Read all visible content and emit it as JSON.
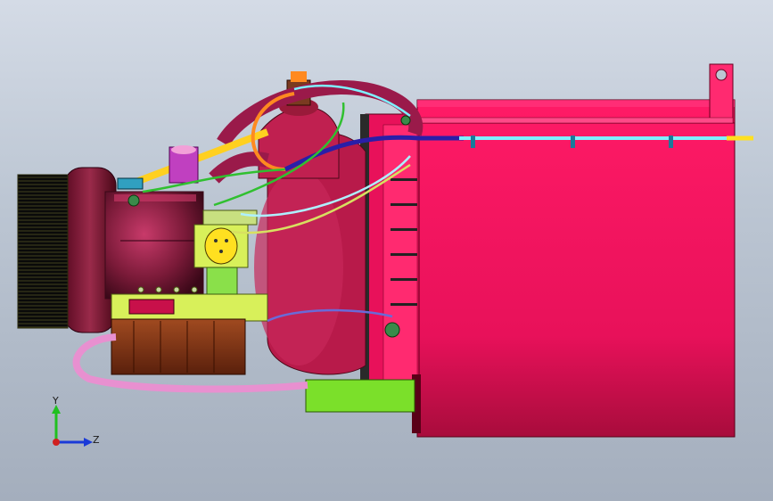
{
  "viewport": {
    "background_top": "#d4dbe6",
    "background_bottom": "#a4aebd"
  },
  "colors": {
    "housing": "#e8115a",
    "housing_dark": "#8b0a2e",
    "blower": "#7a1a38",
    "filter_face": "#111111",
    "pump_yellow": "#d8f05a",
    "pump_brown": "#8a3a1a",
    "green_block": "#7be02a",
    "gas_pipe": "#ffd020",
    "water_pipe": "#e890d0",
    "fuel_line": "#2a1ea8",
    "sensor_line": "#7ef0ff"
  },
  "triad": {
    "y_label": "Y",
    "z_label": "Z",
    "y_color": "#20c020",
    "z_color": "#1a3ad8",
    "origin_color": "#d02020"
  }
}
